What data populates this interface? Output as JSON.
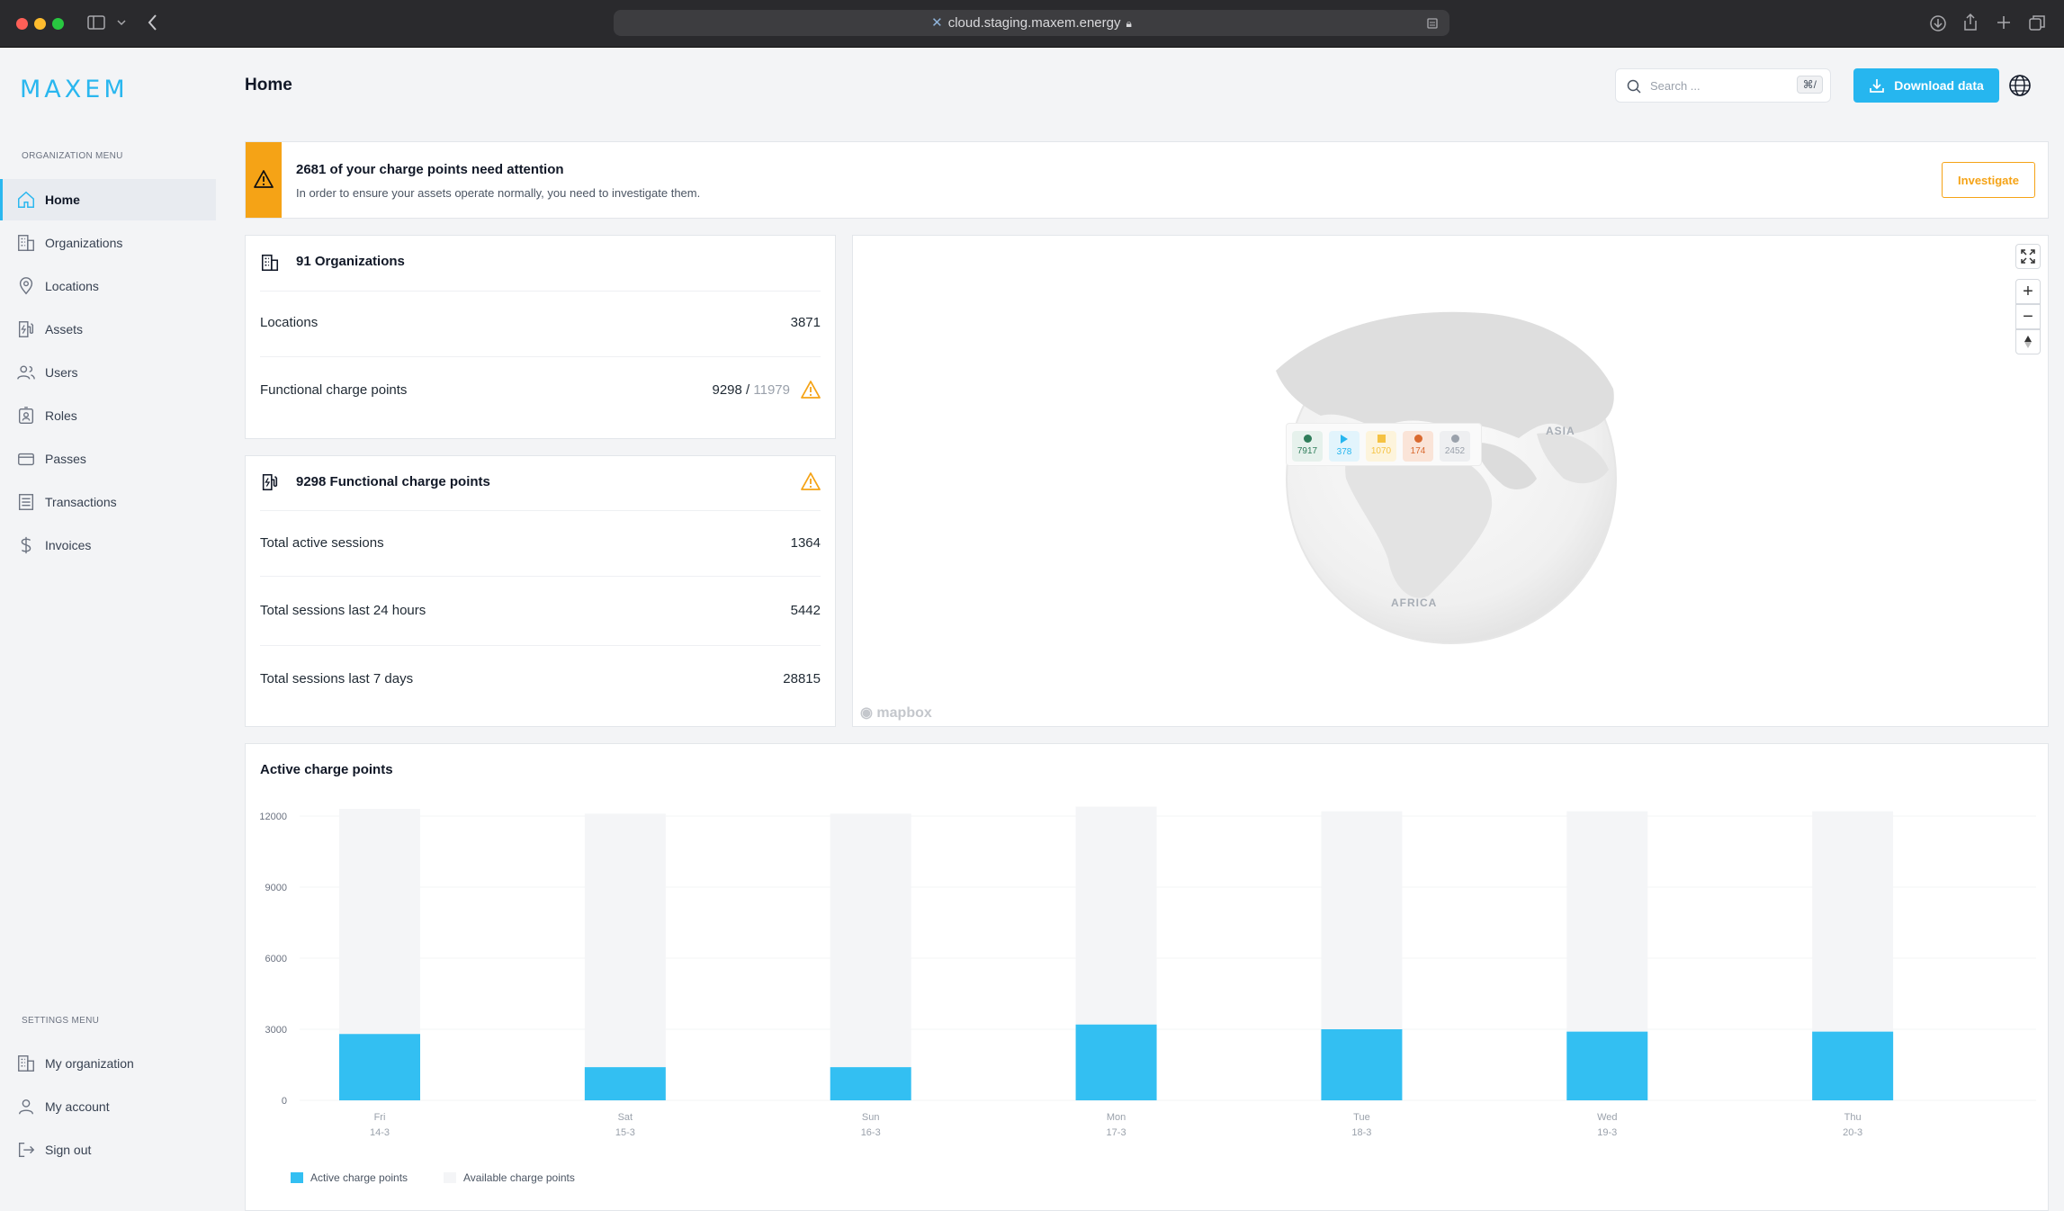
{
  "browser": {
    "url": "cloud.staging.maxem.energy"
  },
  "sidebar": {
    "logo": "MAXEM",
    "org_menu_caption": "ORGANIZATION MENU",
    "items": [
      {
        "label": "Home",
        "icon": "home-icon"
      },
      {
        "label": "Organizations",
        "icon": "building-icon"
      },
      {
        "label": "Locations",
        "icon": "map-pin-icon"
      },
      {
        "label": "Assets",
        "icon": "charger-icon"
      },
      {
        "label": "Users",
        "icon": "users-icon"
      },
      {
        "label": "Roles",
        "icon": "id-badge-icon"
      },
      {
        "label": "Passes",
        "icon": "card-icon"
      },
      {
        "label": "Transactions",
        "icon": "list-icon"
      },
      {
        "label": "Invoices",
        "icon": "dollar-icon"
      }
    ],
    "settings_caption": "SETTINGS MENU",
    "settings_items": [
      {
        "label": "My organization",
        "icon": "building-icon"
      },
      {
        "label": "My account",
        "icon": "user-icon"
      },
      {
        "label": "Sign out",
        "icon": "sign-out-icon"
      }
    ]
  },
  "header": {
    "title": "Home",
    "search_placeholder": "Search ...",
    "search_shortcut": "⌘/",
    "download_label": "Download data"
  },
  "alert": {
    "title": "2681 of your charge points need attention",
    "subtitle": "In order to ensure your assets operate normally, you need to investigate them.",
    "button": "Investigate"
  },
  "orgs_card": {
    "title": "91 Organizations",
    "rows": [
      {
        "label": "Locations",
        "value": "3871"
      },
      {
        "label": "Functional charge points",
        "value": "9298",
        "total": "11979"
      }
    ]
  },
  "cp_card": {
    "title": "9298 Functional charge points",
    "rows": [
      {
        "label": "Total active sessions",
        "value": "1364"
      },
      {
        "label": "Total sessions last 24 hours",
        "value": "5442"
      },
      {
        "label": "Total sessions last 7 days",
        "value": "28815"
      }
    ]
  },
  "map": {
    "legend": [
      {
        "value": "7917",
        "color": "#2f7d5a",
        "shape": "circle"
      },
      {
        "value": "378",
        "color": "#26b6ef",
        "shape": "play"
      },
      {
        "value": "1070",
        "color": "#f5c242",
        "shape": "square"
      },
      {
        "value": "174",
        "color": "#d9692f",
        "shape": "circle"
      },
      {
        "value": "2452",
        "color": "#9aa1ab",
        "shape": "circle"
      }
    ],
    "labels": {
      "asia": "ASIA",
      "africa": "AFRICA"
    },
    "attribution": "mapbox"
  },
  "chart_data": {
    "type": "bar",
    "title": "Active charge points",
    "categories": [
      {
        "day": "Fri",
        "date": "14-3"
      },
      {
        "day": "Sat",
        "date": "15-3"
      },
      {
        "day": "Sun",
        "date": "16-3"
      },
      {
        "day": "Mon",
        "date": "17-3"
      },
      {
        "day": "Tue",
        "date": "18-3"
      },
      {
        "day": "Wed",
        "date": "19-3"
      },
      {
        "day": "Thu",
        "date": "20-3"
      }
    ],
    "ylim": [
      0,
      12000
    ],
    "yticks": [
      "12000",
      "9000",
      "6000",
      "3000",
      "0"
    ],
    "series": [
      {
        "name": "Active charge points",
        "color": "#33bff2",
        "values": [
          2800,
          1400,
          1400,
          3200,
          3000,
          2900,
          2900
        ]
      },
      {
        "name": "Available charge points",
        "color": "#f4f5f7",
        "values": [
          9500,
          10700,
          10700,
          9200,
          9200,
          9300,
          9300
        ]
      }
    ]
  }
}
